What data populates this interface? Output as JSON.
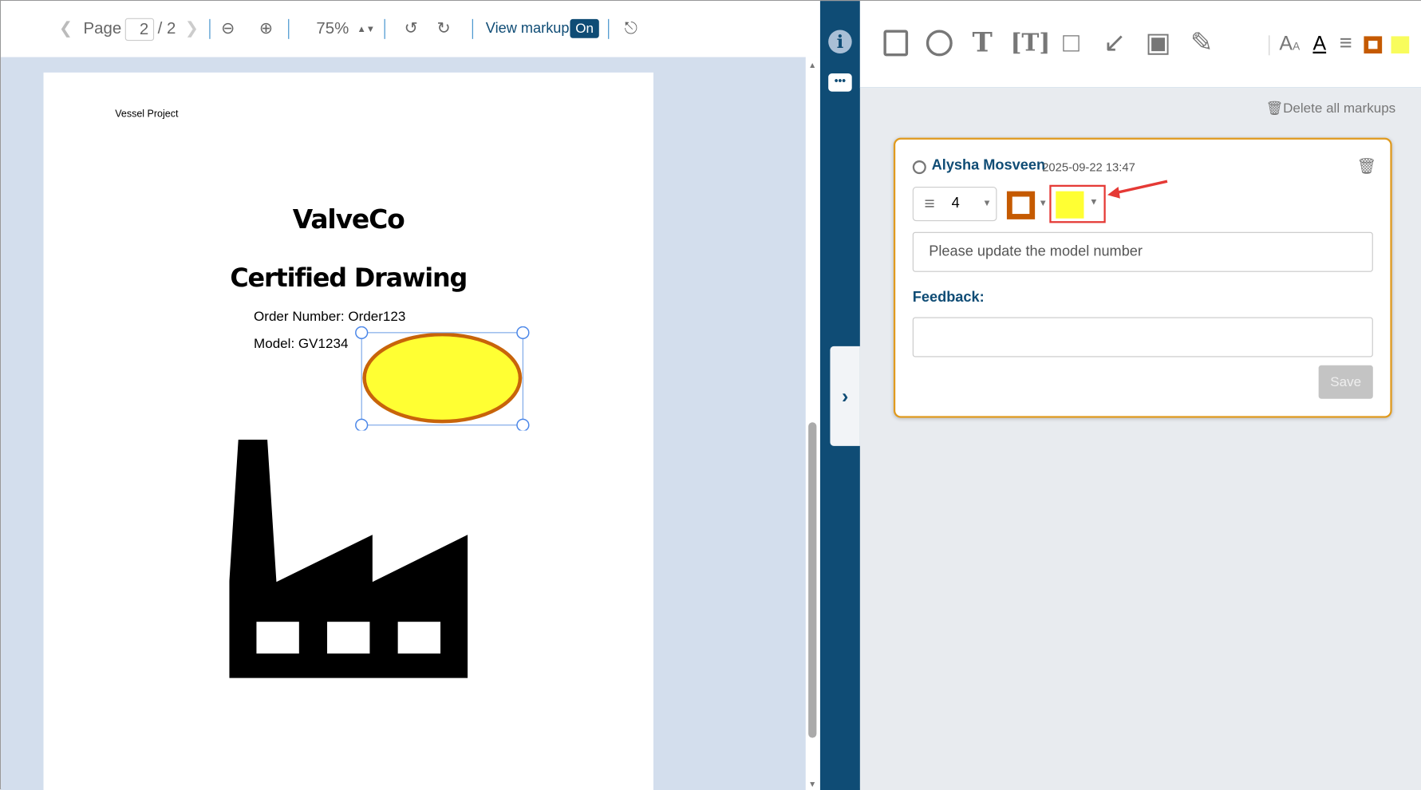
{
  "toolbar": {
    "page_label": "Page",
    "page_current": "2",
    "page_total": "/ 2",
    "zoom": "75%",
    "view_markup_label": "View markup",
    "view_markup_state": "On"
  },
  "document": {
    "header": "Vessel Project",
    "company": "ValveCo",
    "title": "Certified Drawing",
    "order": "Order Number: Order123",
    "model": "Model: GV1234"
  },
  "markup": {
    "ellipse_fill": "#ffff33",
    "ellipse_stroke": "#c8640a"
  },
  "panel": {
    "delete_all": "Delete all markups",
    "author": "Alysha Mosveen",
    "timestamp": "2025-09-22 13:47",
    "line_width": "4",
    "stroke_color": "#c55a00",
    "fill_color": "#ffff33",
    "comment": "Please update the model number",
    "feedback_label": "Feedback:",
    "feedback_value": "",
    "save_label": "Save"
  },
  "colors": {
    "accent": "#0f4c75",
    "card_border": "#e09a1e"
  }
}
